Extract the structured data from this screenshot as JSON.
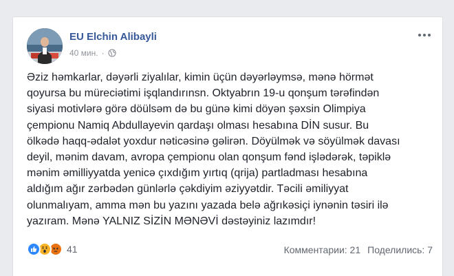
{
  "post": {
    "author": "EU Elchin Alibayli",
    "time": "40 мин.",
    "separator": "·",
    "privacy_icon": "globe-icon",
    "more_icon": "more-options-icon",
    "text_lines": [
      "Əziz həmkarlar, dəyərli ziyalılar, kimin üçün dəyərləymsə, mənə hörmət",
      "qoyursa bu müreciətimi işqlandırınsn. Oktyabrın 19-u qonşum tərəfindən",
      "siyasi motivlərə görə döülsəm də bu günə kimi döyən şəxsin Olimpiya",
      "çempionu Namiq Abdullayevin qardaşı olması hesabına DİN susur. Bu",
      "ölkədə haqq-ədalət yoxdur nəticəsinə gəlirən. Döyülmək və söyülmək davası",
      "deyil, mənim davam, avropa çempionu olan qonşum fənd işlədərək, təpiklə",
      "mənim əmilliyyatda yenicə çıxdığım yırtıq (qrija) partladması hesabına",
      "aldığım ağır zərbədən günlərlə çəkdiyim əziyyətdir. Təcili əmiliyyat",
      "olunmalıyam, amma mən bu yazını yazada belə ağrıkəsiçi iynənin təsiri ilə",
      "yazıram. Mənə YALNIZ SİZİN MƏNƏVİ dəstəyiniz lazımdır!"
    ]
  },
  "reactions": {
    "icons": [
      "like-reaction-icon",
      "wow-reaction-icon",
      "angry-reaction-icon"
    ],
    "count": "41"
  },
  "stats": {
    "comments": "Комментарии: 21",
    "shares": "Поделились: 7"
  },
  "colors": {
    "background": "#e9ebee",
    "author_link": "#365899",
    "like": "#2d88ff",
    "wow": "#f7b125",
    "angry": "#e9710f"
  }
}
